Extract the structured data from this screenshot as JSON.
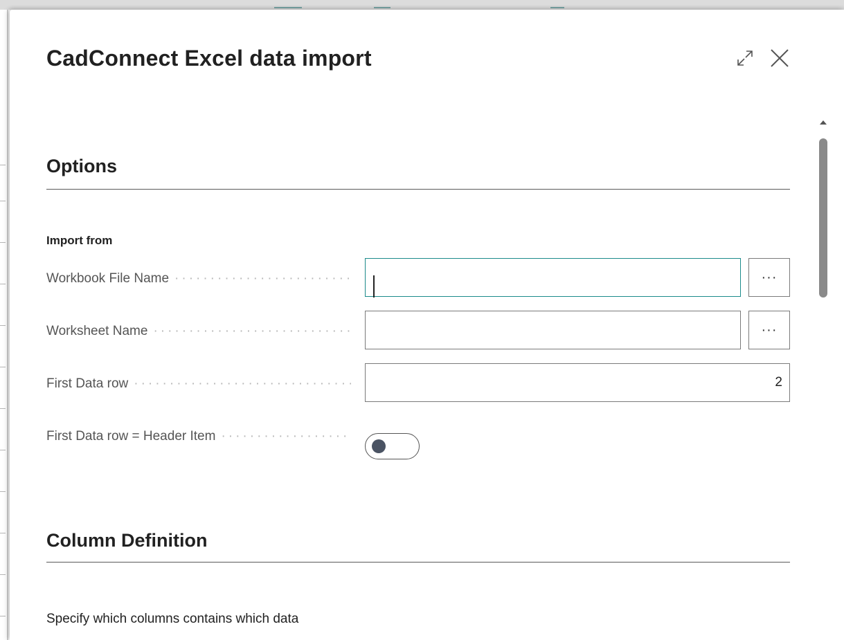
{
  "dialog": {
    "title": "CadConnect Excel data import",
    "expand_icon": "expand-icon",
    "close_icon": "close-icon",
    "accent_color": "#1a8a8a"
  },
  "options": {
    "title": "Options",
    "group_label": "Import from",
    "fields": {
      "workbook": {
        "label": "Workbook File Name",
        "value": "",
        "lookup_label": "···"
      },
      "worksheet": {
        "label": "Worksheet Name",
        "value": "",
        "lookup_label": "···"
      },
      "first_row": {
        "label": "First Data row",
        "value": "2"
      },
      "header_item": {
        "label": "First Data row = Header Item",
        "checked": false
      }
    }
  },
  "column_definition": {
    "title": "Column Definition",
    "description": "Specify which columns contains which data"
  }
}
